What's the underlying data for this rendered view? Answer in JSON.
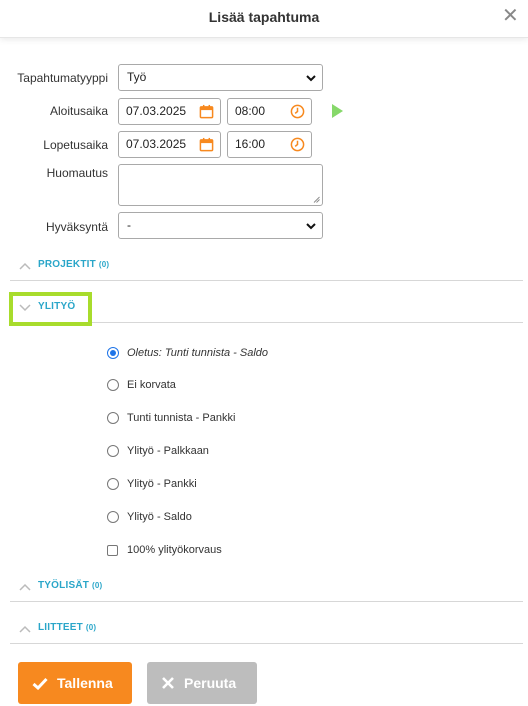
{
  "dialog": {
    "title": "Lisää tapahtuma",
    "close_icon": "close-icon"
  },
  "form": {
    "event_type": {
      "label": "Tapahtumatyyppi",
      "value": "Työ"
    },
    "start": {
      "label": "Aloitusaika",
      "date": "07.03.2025",
      "time": "08:00"
    },
    "end": {
      "label": "Lopetusaika",
      "date": "07.03.2025",
      "time": "16:00"
    },
    "note": {
      "label": "Huomautus",
      "value": ""
    },
    "approval": {
      "label": "Hyväksyntä",
      "value": "-"
    }
  },
  "sections": {
    "projects": {
      "label": "PROJEKTIT",
      "count": "(0)",
      "expanded": false
    },
    "overtime": {
      "label": "YLITYÖ",
      "expanded": true
    },
    "work_extras": {
      "label": "TYÖLISÄT",
      "count": "(0)",
      "expanded": false
    },
    "attachments": {
      "label": "LIITTEET",
      "count": "(0)",
      "expanded": false
    }
  },
  "overtime_options": [
    {
      "label": "Oletus: Tunti tunnista - Saldo",
      "checked": true,
      "italic": true
    },
    {
      "label": "Ei korvata",
      "checked": false
    },
    {
      "label": "Tunti tunnista - Pankki",
      "checked": false
    },
    {
      "label": "Ylityö - Palkkaan",
      "checked": false
    },
    {
      "label": "Ylityö - Pankki",
      "checked": false
    },
    {
      "label": "Ylityö - Saldo",
      "checked": false
    }
  ],
  "overtime_checkbox": {
    "label": "100% ylityökorvaus",
    "checked": false
  },
  "buttons": {
    "save": "Tallenna",
    "cancel": "Peruuta"
  },
  "colors": {
    "accent_orange": "#f7891f",
    "section_blue": "#2aa6c9",
    "highlight_green": "#a8dc2c",
    "play_green": "#86d86a",
    "radio_blue": "#1e74e8",
    "cancel_gray": "#bdbdbd"
  }
}
